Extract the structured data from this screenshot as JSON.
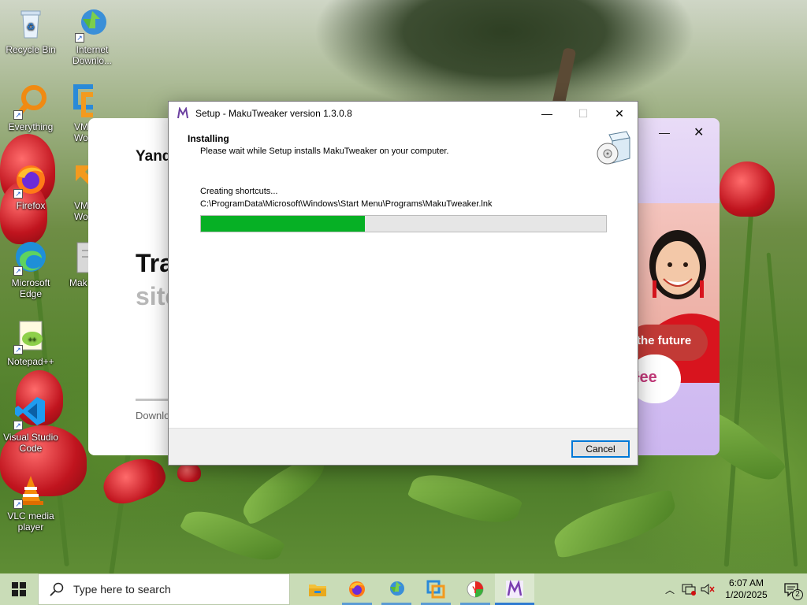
{
  "desktop": {
    "icons": [
      {
        "label": "Recycle Bin",
        "icon": "recycle-bin-icon"
      },
      {
        "label": "Internet Downlo...",
        "icon": "internet-download-manager-icon"
      },
      {
        "label": "Everything",
        "icon": "everything-search-icon"
      },
      {
        "label": "VM Wor",
        "icon": "vmware-workstation-icon"
      },
      {
        "label": "Firefox",
        "icon": "firefox-icon"
      },
      {
        "label": "VM Wor",
        "icon": "vmware-player-icon"
      },
      {
        "label": "Microsoft Edge",
        "icon": "edge-icon"
      },
      {
        "label": "Mak",
        "icon": "makutweaker-icon"
      },
      {
        "label": "Notepad++",
        "icon": "notepad-plus-plus-icon"
      },
      {
        "label": "Visual Studio Code",
        "icon": "vscode-icon"
      },
      {
        "label": "VLC media player",
        "icon": "vlc-icon"
      }
    ]
  },
  "yandex_window": {
    "brand": "Yand",
    "headline": "Tra",
    "subline": "site",
    "download_label": "Downlo"
  },
  "promo_window": {
    "pill_text": "the future",
    "brand_text": "Ɨee"
  },
  "setup": {
    "title": "Setup - MakuTweaker version 1.3.0.8",
    "heading": "Installing",
    "subheading": "Please wait while Setup installs MakuTweaker on your computer.",
    "status": "Creating shortcuts...",
    "current_file": "C:\\ProgramData\\Microsoft\\Windows\\Start Menu\\Programs\\MakuTweaker.lnk",
    "progress_percent": 40.5,
    "cancel_label": "Cancel",
    "colors": {
      "progress_fill": "#06b025",
      "button_focus": "#0078d7"
    }
  },
  "taskbar": {
    "search_placeholder": "Type here to search",
    "apps": [
      "file-explorer-icon",
      "firefox-icon",
      "internet-download-manager-icon",
      "vmware-icon",
      "yandex-browser-icon",
      "makutweaker-icon"
    ],
    "time": "6:07 AM",
    "date": "1/20/2025",
    "notification_count": "2"
  }
}
